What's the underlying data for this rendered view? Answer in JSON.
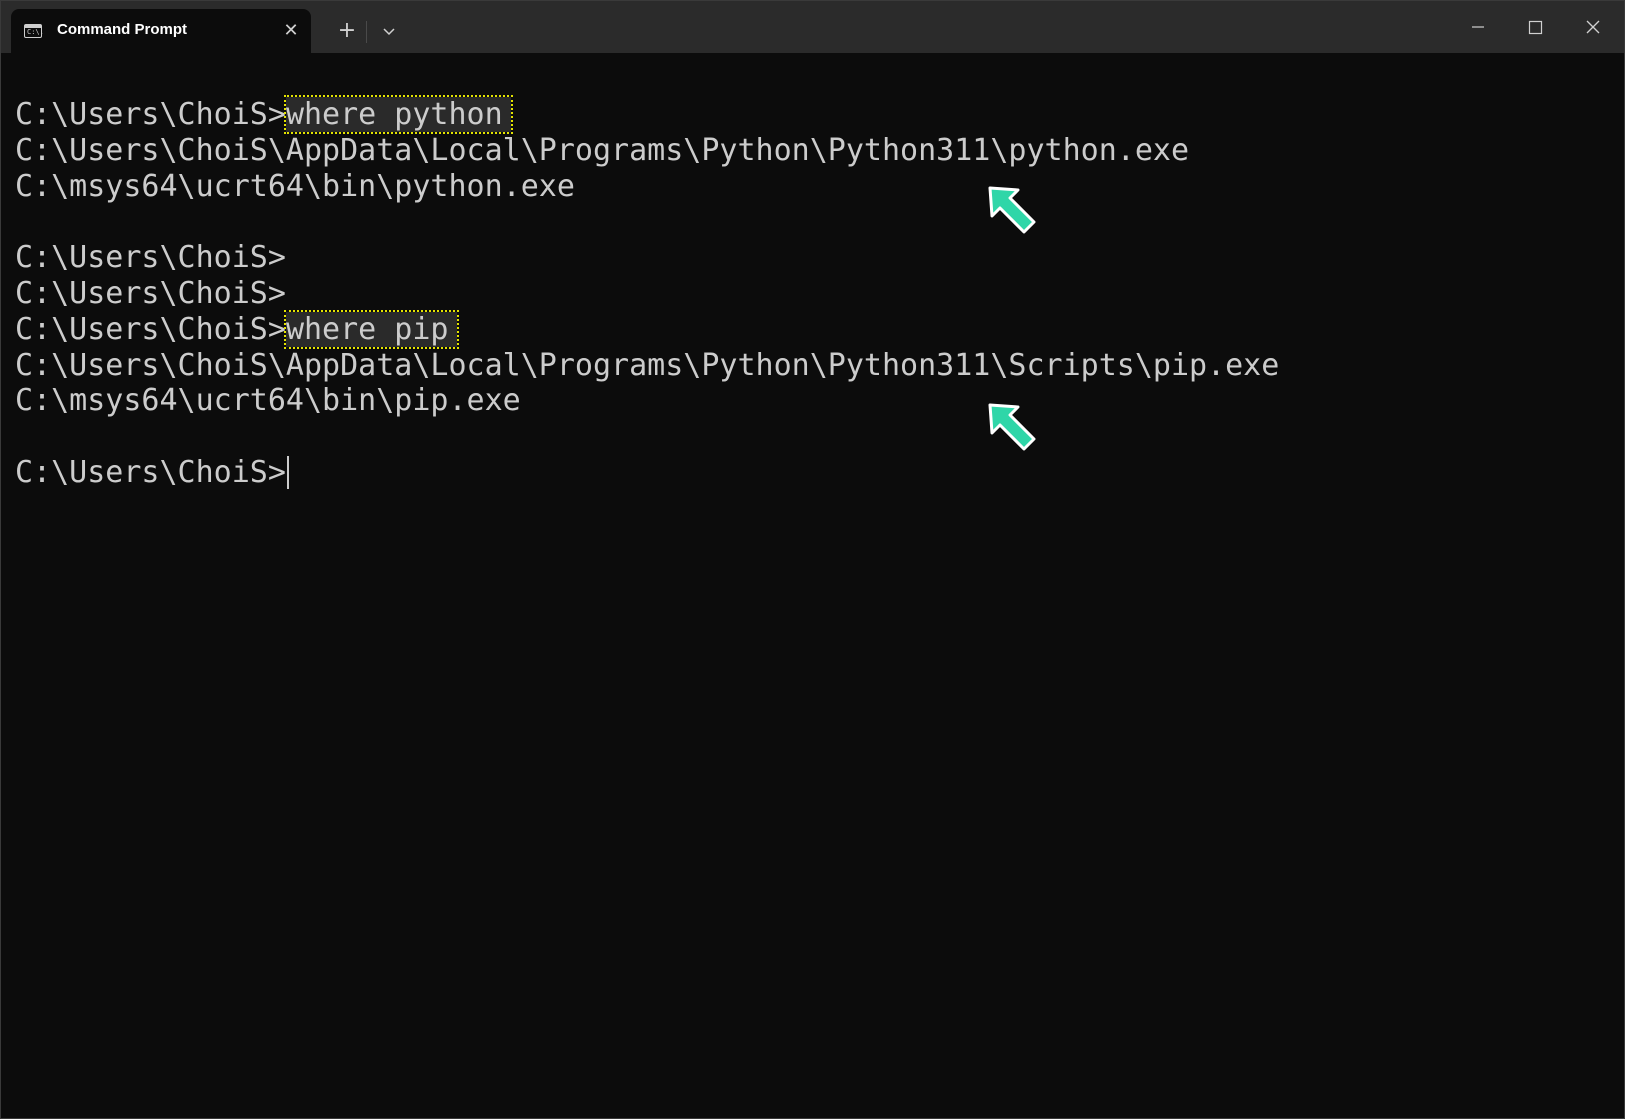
{
  "window": {
    "tab_title": "Command Prompt",
    "tab_icon": "cmd-icon",
    "tab_icon_text": "C:\\.",
    "new_tab_symbol": "+",
    "close_tab_symbol": "✕"
  },
  "terminal": {
    "lines": [
      {
        "prompt": "C:\\Users\\ChoiS>",
        "command": "where python"
      },
      {
        "text": "C:\\Users\\ChoiS\\AppData\\Local\\Programs\\Python\\Python311\\python.exe"
      },
      {
        "text": "C:\\msys64\\ucrt64\\bin\\python.exe"
      },
      {
        "text": ""
      },
      {
        "text": "C:\\Users\\ChoiS>"
      },
      {
        "text": "C:\\Users\\ChoiS>"
      },
      {
        "prompt": "C:\\Users\\ChoiS>",
        "command": "where pip"
      },
      {
        "text": "C:\\Users\\ChoiS\\AppData\\Local\\Programs\\Python\\Python311\\Scripts\\pip.exe"
      },
      {
        "text": "C:\\msys64\\ucrt64\\bin\\pip.exe"
      },
      {
        "text": ""
      },
      {
        "prompt": "C:\\Users\\ChoiS>",
        "cursor": true
      }
    ]
  },
  "annotations": {
    "arrow_color": "#2fd6a8",
    "highlight_color": "#e3e300",
    "arrow_icon": "arrow-up-left-icon"
  }
}
